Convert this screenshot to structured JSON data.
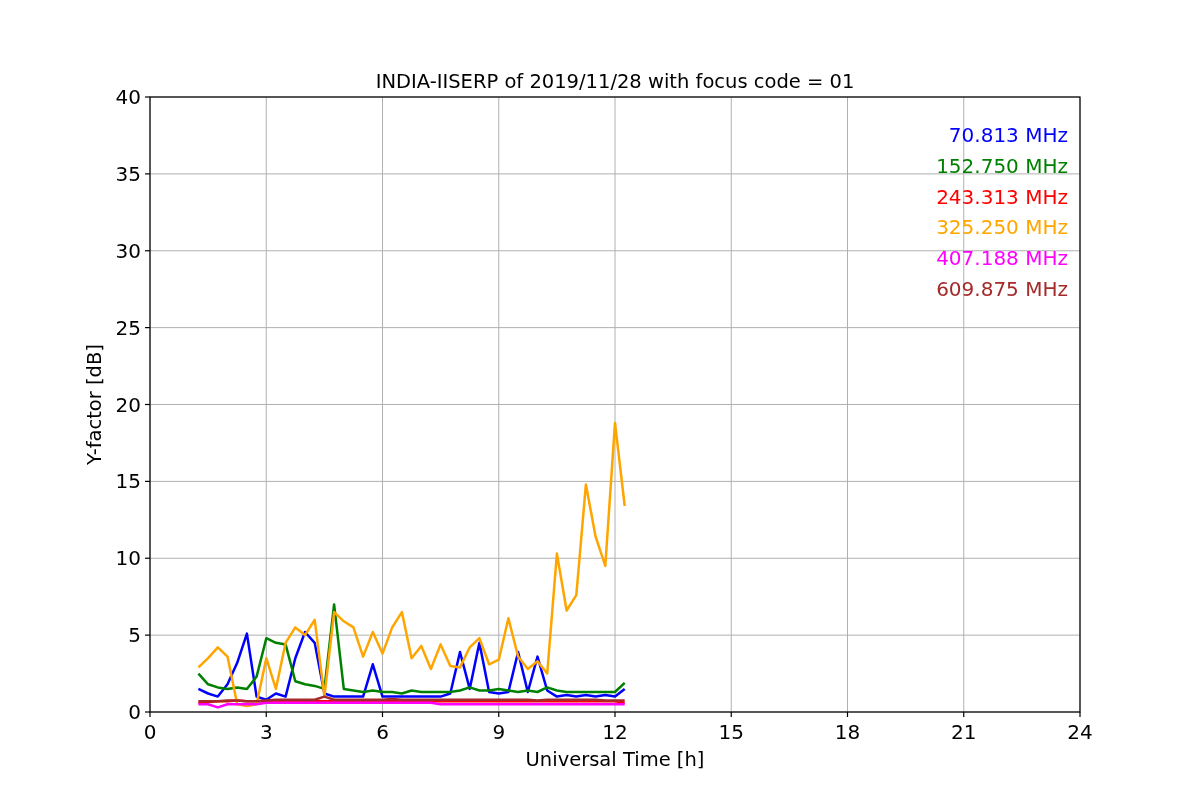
{
  "chart_data": {
    "type": "line",
    "title": "INDIA-IISERP of 2019/11/28 with focus code = 01",
    "xlabel": "Universal Time [h]",
    "ylabel": "Y-factor [dB]",
    "x": [
      1.25,
      1.5,
      1.75,
      2,
      2.25,
      2.5,
      2.75,
      3,
      3.25,
      3.5,
      3.75,
      4,
      4.25,
      4.5,
      4.75,
      5,
      5.25,
      5.5,
      5.75,
      6,
      6.25,
      6.5,
      6.75,
      7,
      7.25,
      7.5,
      7.75,
      8,
      8.25,
      8.5,
      8.75,
      9,
      9.25,
      9.5,
      9.75,
      10,
      10.25,
      10.5,
      10.75,
      11,
      11.25,
      11.5,
      11.75,
      12,
      12.25
    ],
    "series": [
      {
        "name": "70.813 MHz",
        "color": "#0000ff",
        "values": [
          1.5,
          1.2,
          1.0,
          1.8,
          3.2,
          5.1,
          1.0,
          0.8,
          1.2,
          1.0,
          3.5,
          5.2,
          4.5,
          1.2,
          1.0,
          1.0,
          1.0,
          1.0,
          3.1,
          1.0,
          1.0,
          1.0,
          1.0,
          1.0,
          1.0,
          1.0,
          1.2,
          3.9,
          1.5,
          4.5,
          1.3,
          1.2,
          1.3,
          3.9,
          1.3,
          3.6,
          1.4,
          1.0,
          1.1,
          1.0,
          1.1,
          1.0,
          1.1,
          1.0,
          1.5
        ]
      },
      {
        "name": "152.750 MHz",
        "color": "#008000",
        "values": [
          2.5,
          1.8,
          1.6,
          1.5,
          1.6,
          1.5,
          2.3,
          4.8,
          4.5,
          4.4,
          2.0,
          1.8,
          1.7,
          1.5,
          7.0,
          1.5,
          1.4,
          1.3,
          1.4,
          1.3,
          1.3,
          1.2,
          1.4,
          1.3,
          1.3,
          1.3,
          1.3,
          1.4,
          1.6,
          1.4,
          1.4,
          1.5,
          1.4,
          1.3,
          1.4,
          1.3,
          1.6,
          1.4,
          1.3,
          1.3,
          1.3,
          1.3,
          1.3,
          1.3,
          1.9
        ]
      },
      {
        "name": "243.313 MHz",
        "color": "#ff0000",
        "values": [
          0.6,
          0.65,
          0.7,
          0.7,
          0.75,
          0.7,
          0.7,
          0.7,
          0.7,
          0.7,
          0.7,
          0.7,
          0.7,
          0.7,
          0.7,
          0.7,
          0.7,
          0.7,
          0.7,
          0.7,
          0.7,
          0.7,
          0.7,
          0.7,
          0.7,
          0.7,
          0.7,
          0.7,
          0.7,
          0.7,
          0.7,
          0.7,
          0.7,
          0.7,
          0.7,
          0.7,
          0.7,
          0.7,
          0.7,
          0.7,
          0.7,
          0.7,
          0.7,
          0.7,
          0.6
        ]
      },
      {
        "name": "325.250 MHz",
        "color": "#ffa500",
        "values": [
          2.9,
          3.5,
          4.2,
          3.6,
          0.5,
          0.4,
          0.5,
          3.5,
          1.5,
          4.5,
          5.5,
          5.0,
          6.0,
          1.0,
          6.5,
          5.9,
          5.5,
          3.6,
          5.2,
          3.8,
          5.5,
          6.5,
          3.5,
          4.3,
          2.8,
          4.4,
          3.0,
          2.9,
          4.2,
          4.8,
          3.1,
          3.4,
          6.1,
          3.6,
          2.8,
          3.3,
          2.5,
          10.3,
          6.6,
          7.6,
          14.8,
          11.4,
          9.5,
          18.8,
          13.4
        ]
      },
      {
        "name": "407.188 MHz",
        "color": "#ff00ff",
        "values": [
          0.5,
          0.5,
          0.3,
          0.5,
          0.5,
          0.5,
          0.5,
          0.6,
          0.6,
          0.6,
          0.6,
          0.6,
          0.6,
          0.6,
          0.6,
          0.6,
          0.6,
          0.6,
          0.6,
          0.6,
          0.6,
          0.6,
          0.6,
          0.6,
          0.6,
          0.5,
          0.5,
          0.5,
          0.5,
          0.5,
          0.5,
          0.5,
          0.5,
          0.5,
          0.5,
          0.5,
          0.5,
          0.5,
          0.5,
          0.5,
          0.5,
          0.5,
          0.5,
          0.5,
          0.5
        ]
      },
      {
        "name": "609.875 MHz",
        "color": "#a52a2a",
        "values": [
          0.7,
          0.7,
          0.7,
          0.75,
          0.75,
          0.7,
          0.7,
          0.75,
          0.8,
          0.8,
          0.8,
          0.8,
          0.8,
          1.0,
          0.8,
          0.8,
          0.8,
          0.8,
          0.8,
          0.8,
          0.85,
          0.8,
          0.8,
          0.8,
          0.8,
          0.8,
          0.8,
          0.8,
          0.8,
          0.8,
          0.8,
          0.8,
          0.8,
          0.8,
          0.8,
          0.75,
          0.8,
          0.8,
          0.8,
          0.8,
          0.8,
          0.8,
          0.75,
          0.75,
          0.75
        ]
      }
    ],
    "grid": true,
    "xlim": [
      0,
      24
    ],
    "ylim": [
      0,
      40
    ],
    "xticks": [
      0,
      3,
      6,
      9,
      12,
      15,
      18,
      21,
      24
    ],
    "yticks": [
      0,
      5,
      10,
      15,
      20,
      25,
      30,
      35,
      40
    ]
  }
}
